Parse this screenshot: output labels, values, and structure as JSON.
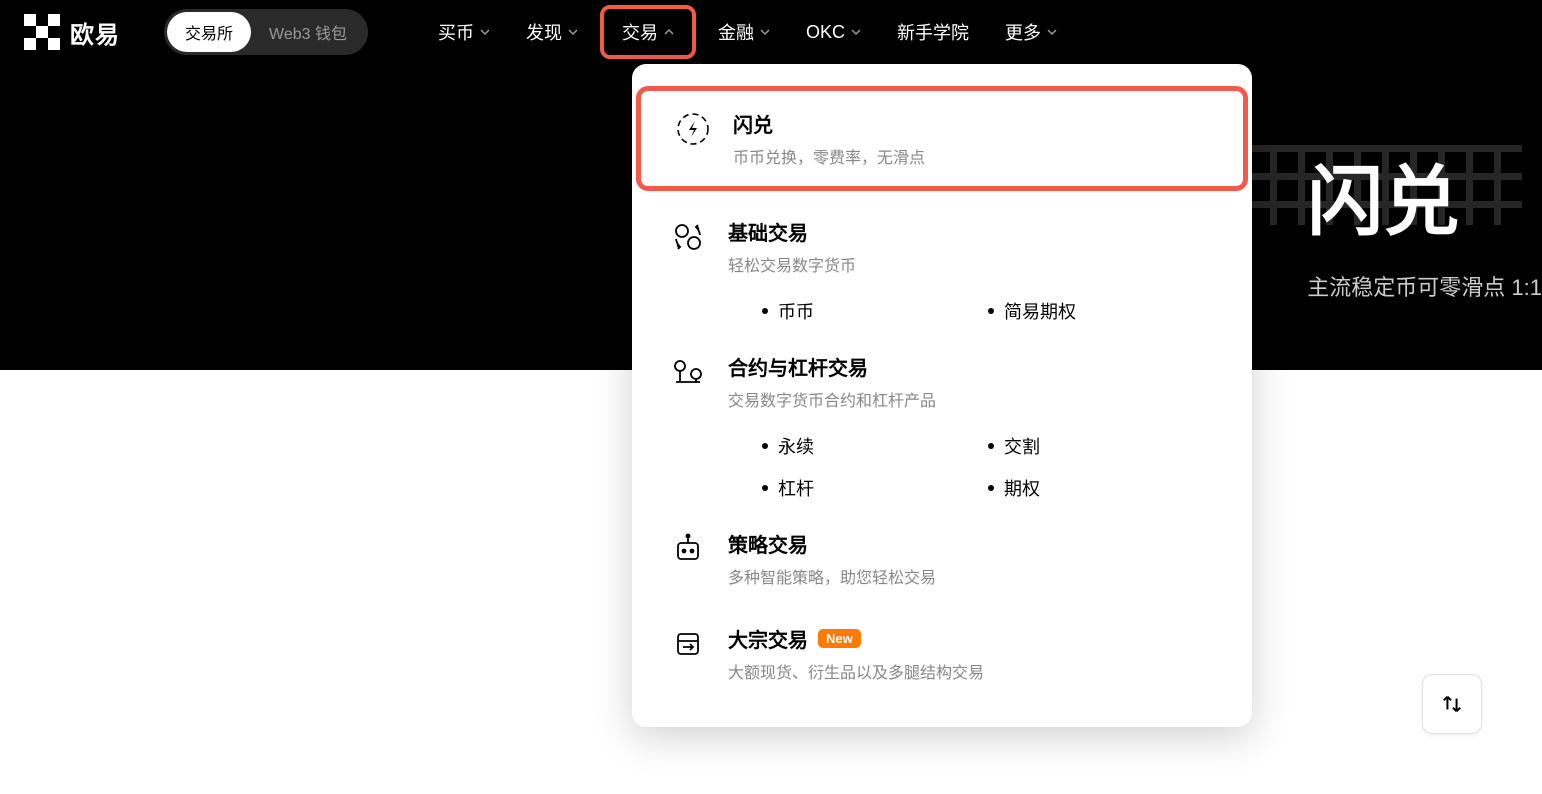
{
  "header": {
    "brand": "欧易",
    "toggle": {
      "exchange": "交易所",
      "wallet": "Web3 钱包"
    },
    "nav": [
      {
        "label": "买币",
        "hasDropdown": true
      },
      {
        "label": "发现",
        "hasDropdown": true
      },
      {
        "label": "交易",
        "hasDropdown": true,
        "highlighted": true
      },
      {
        "label": "金融",
        "hasDropdown": true
      },
      {
        "label": "OKC",
        "hasDropdown": true
      },
      {
        "label": "新手学院",
        "hasDropdown": false
      },
      {
        "label": "更多",
        "hasDropdown": true
      }
    ]
  },
  "hero": {
    "title": "闪兑",
    "subtitle": "主流稳定币可零滑点 1:1"
  },
  "dropdown": {
    "sections": [
      {
        "icon": "flash",
        "title": "闪兑",
        "desc": "币币兑换，零费率，无滑点",
        "highlighted": true
      },
      {
        "icon": "exchange",
        "title": "基础交易",
        "desc": "轻松交易数字货币",
        "subs": [
          "币币",
          "简易期权"
        ]
      },
      {
        "icon": "balance",
        "title": "合约与杠杆交易",
        "desc": "交易数字货币合约和杠杆产品",
        "subs": [
          "永续",
          "交割",
          "杠杆",
          "期权"
        ]
      },
      {
        "icon": "robot",
        "title": "策略交易",
        "desc": "多种智能策略，助您轻松交易"
      },
      {
        "icon": "block",
        "title": "大宗交易",
        "desc": "大额现货、衍生品以及多腿结构交易",
        "badge": "New"
      }
    ]
  }
}
